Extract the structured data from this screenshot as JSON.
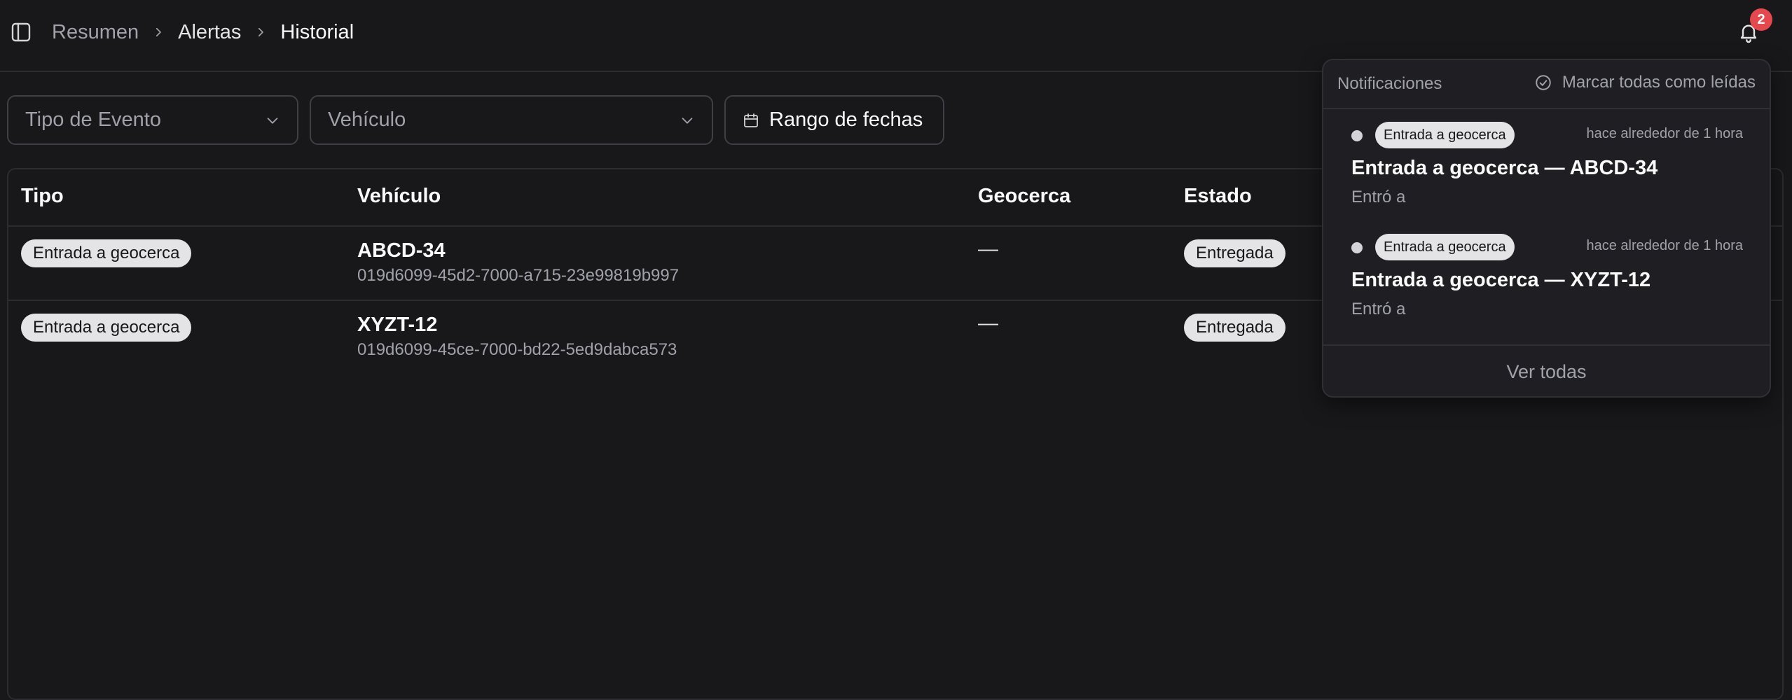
{
  "header": {
    "breadcrumb": [
      "Resumen",
      "Alertas",
      "Historial"
    ],
    "notification_count": "2"
  },
  "filters": {
    "event_type": {
      "placeholder": "Tipo de Evento"
    },
    "vehicle": {
      "placeholder": "Vehículo"
    },
    "date_range": {
      "label": "Rango de fechas"
    }
  },
  "table": {
    "columns": [
      "Tipo",
      "Vehículo",
      "Geocerca",
      "Estado"
    ],
    "rows": [
      {
        "type": "Entrada a geocerca",
        "vehicle": "ABCD-34",
        "vehicle_id": "019d6099-45d2-7000-a715-23e99819b997",
        "geofence": "—",
        "status": "Entregada"
      },
      {
        "type": "Entrada a geocerca",
        "vehicle": "XYZT-12",
        "vehicle_id": "019d6099-45ce-7000-bd22-5ed9dabca573",
        "geofence": "—",
        "status": "Entregada"
      }
    ]
  },
  "notifications": {
    "title": "Notificaciones",
    "mark_all": "Marcar todas como leídas",
    "items": [
      {
        "tag": "Entrada a geocerca",
        "time": "hace alrededor de 1 hora",
        "title": "Entrada a geocerca — ABCD-34",
        "message": "Entró a"
      },
      {
        "tag": "Entrada a geocerca",
        "time": "hace alrededor de 1 hora",
        "title": "Entrada a geocerca — XYZT-12",
        "message": "Entró a"
      }
    ],
    "view_all": "Ver todas"
  },
  "icons": {
    "sidebar_toggle": "panel-left-icon",
    "breadcrumb_separator": "chevron-right-icon",
    "notifications": "bell-icon",
    "select_arrow": "chevron-down-icon",
    "date": "calendar-icon",
    "mark_all": "circle-check-icon"
  },
  "colors": {
    "background": "#18181b",
    "badge": "#e5484d",
    "pill": "#e4e4e7"
  }
}
